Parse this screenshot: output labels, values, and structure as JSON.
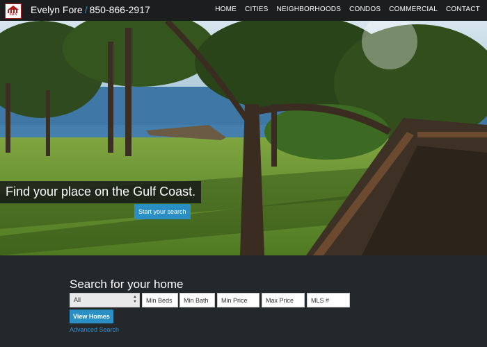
{
  "header": {
    "logo_text": "ERA",
    "name": "Evelyn Fore",
    "separator": "/",
    "phone": "850-866-2917",
    "nav": [
      "HOME",
      "CITIES",
      "NEIGHBORHOODS",
      "CONDOS",
      "COMMERCIAL",
      "CONTACT"
    ]
  },
  "hero": {
    "tagline": "Find your place on the Gulf Coast.",
    "cta_label": "Start your search"
  },
  "search": {
    "title": "Search for your home",
    "city_select": "All",
    "min_beds_placeholder": "Min Beds",
    "min_bath_placeholder": "Min Bath",
    "min_price_placeholder": "Min Price",
    "max_price_placeholder": "Max Price",
    "mls_placeholder": "MLS #",
    "view_button": "View Homes",
    "advanced_link": "Advanced Search"
  },
  "colors": {
    "accent": "#2a8fc4",
    "topbar": "#1b1d1f",
    "background": "#24282b",
    "logo_red": "#b31b1b"
  }
}
